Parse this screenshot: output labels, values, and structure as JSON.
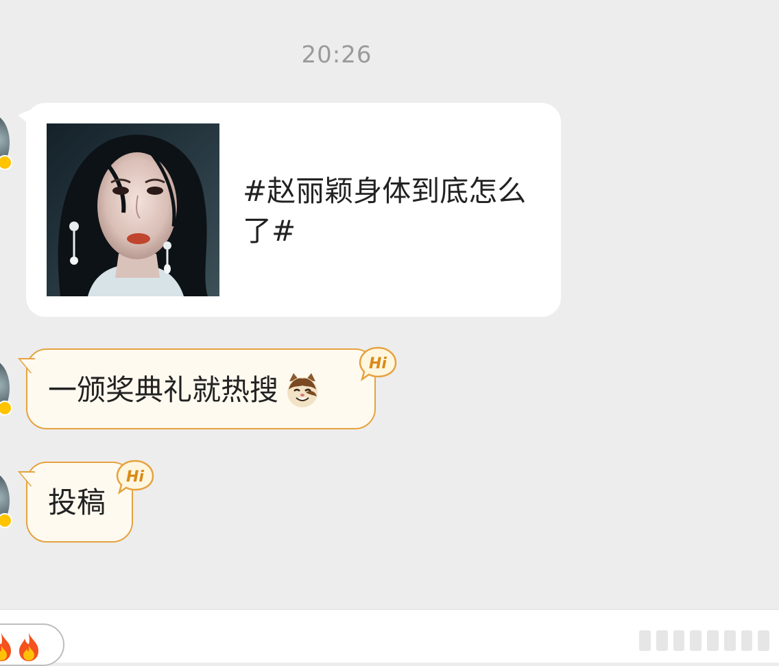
{
  "chat": {
    "timestamp": "20:26",
    "messages": [
      {
        "type": "topic-card",
        "text": "#赵丽颖身体到底怎么了#",
        "image_icon": "portrait-image"
      },
      {
        "type": "fan-bubble",
        "text": "一颁奖典礼就热搜",
        "emoji_icon": "cat-face-icon",
        "badge": "Hi"
      },
      {
        "type": "fan-bubble",
        "text": "投稿",
        "badge": "Hi"
      }
    ]
  },
  "bottom_bar": {
    "reaction_icons": [
      "fire-icon",
      "fire-icon"
    ]
  },
  "colors": {
    "background": "#ededed",
    "fan_bubble_border": "#e5a23e",
    "fan_bubble_fill": "#fffaf0",
    "badge": "#ffc300"
  }
}
